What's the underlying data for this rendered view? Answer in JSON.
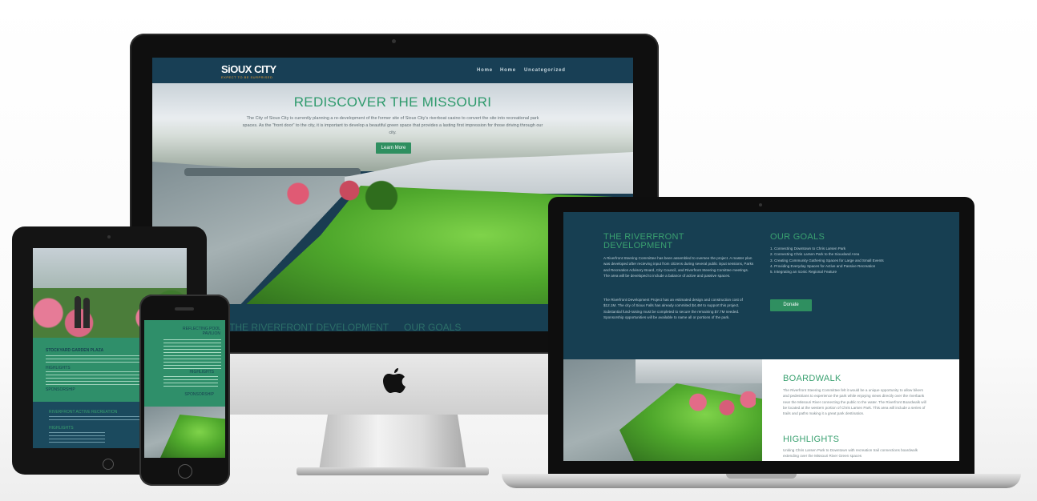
{
  "imac": {
    "logo_main": "SiOUX CITY",
    "logo_sub": "EXPECT TO BE SURPRISED",
    "nav": [
      "Home",
      "Home",
      "Uncategorized"
    ],
    "hero_title": "REDISCOVER THE MISSOURI",
    "hero_text": "The City of Sioux City is currently planning a re-development of the former site of Sioux City's riverboat casino to convert the site into recreational park spaces. As the \"front door\" to the city, it is important to develop a beautiful green space that provides a lasting first impression for those driving through our city.",
    "hero_button": "Learn More",
    "peek_left": "THE RIVERFRONT DEVELOPMENT",
    "peek_right": "OUR GOALS"
  },
  "laptop": {
    "riverfront_title": "THE RIVERFRONT DEVELOPMENT",
    "riverfront_p1": "A Riverfront Steering Committee has been assembled to oversee the project. A master plan was developed after recieving input from citizens during several public input sessions, Parks and Recreation Advisory Board, City Council, and Riverfront Steering Comittee meetings. The area will be developed to include a balance of active and passive spaces.",
    "riverfront_p2": "The Riverfront Development Project has an estimated design and construction cost of $12.1M. The city of Sioux Falls has already commited $4.4M to support this project. Substantial fund-raising must be completed to secure the remaining $7.7M needed. Sponsorship opportunities will be available to name all or portions of the park.",
    "goals_title": "OUR GOALS",
    "goals": [
      "1. Connecting Downtown to Chris Larsen Park",
      "2. Connecting Chris Larsen Park to the Siouxland Area",
      "3. Creating Community Gathering Spaces for Large and Small Events",
      "4. Providing Everyday Spaces for Active and Passive Recreation",
      "5. Integrating an Iconic Regional Feature"
    ],
    "donate_button": "Donate",
    "boardwalk_title": "BOARDWALK",
    "boardwalk_text": "The Riverfront Steering Committee felt it would be a unique opportunity to allow bikers and pedestrians to experience the park while enjoying views directly over the riverbank near the Missouri River connecting the public to the water. The Riverfront Boardwalk will be located at the western portion of Chris Larsen Park. This area will include a series of trails and paths making it a great park destination.",
    "highlights_title": "HIGHLIGHTS",
    "highlights_text": "Uniting Chris Larsen Park to Downtown with recreation trail connections boardwalk extending over the Missouri River Green spaces"
  },
  "tablet": {
    "title1": "STOCKYARD GARDEN PLAZA",
    "highlights": "HIGHLIGHTS",
    "sponsorship": "SPONSORSHIP",
    "title2": "RIVERFRONT ACTIVE RECREATION",
    "highlights2": "HIGHLIGHTS"
  },
  "phone": {
    "title": "REFLECTING POOL PAVILION",
    "highlights": "HIGHLIGHTS",
    "sponsorship": "SPONSORSHIP"
  },
  "colors": {
    "navy": "#173f52",
    "accent_green": "#3aa170",
    "button_green": "#2f8f60"
  }
}
